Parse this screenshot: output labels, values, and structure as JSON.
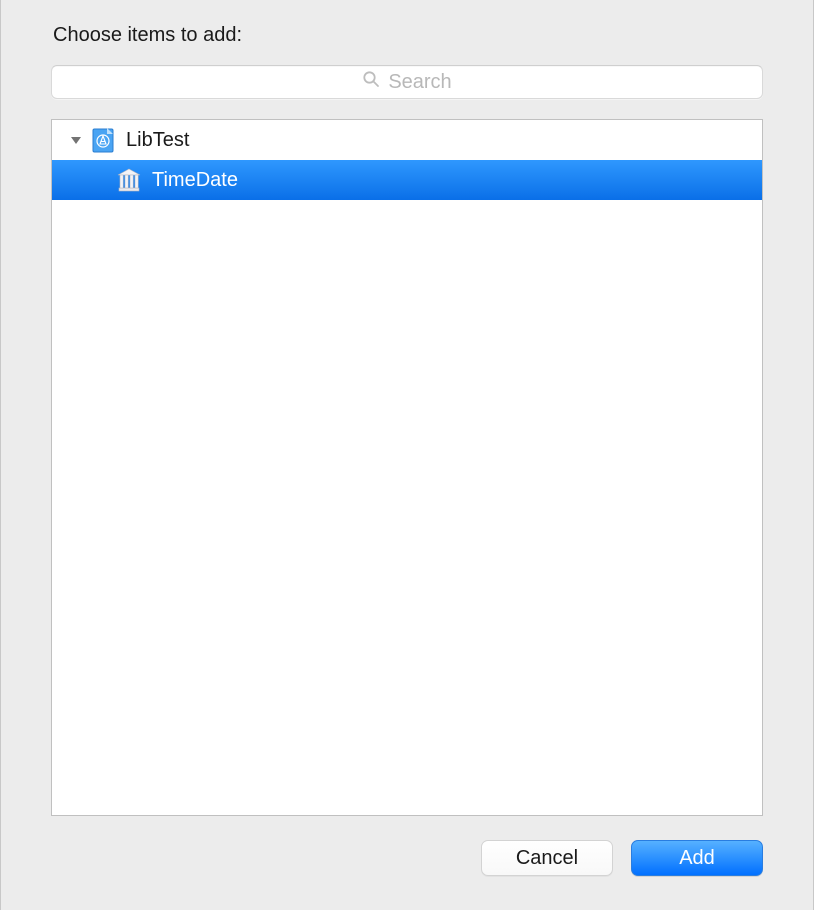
{
  "dialog": {
    "title": "Choose items to add:",
    "search": {
      "placeholder": "Search",
      "value": ""
    },
    "tree": {
      "items": [
        {
          "label": "LibTest",
          "icon": "app-blueprint-icon",
          "expanded": true,
          "selected": false,
          "indent": 0
        },
        {
          "label": "TimeDate",
          "icon": "library-building-icon",
          "expanded": false,
          "selected": true,
          "indent": 1
        }
      ]
    },
    "buttons": {
      "cancel": "Cancel",
      "add": "Add"
    }
  }
}
